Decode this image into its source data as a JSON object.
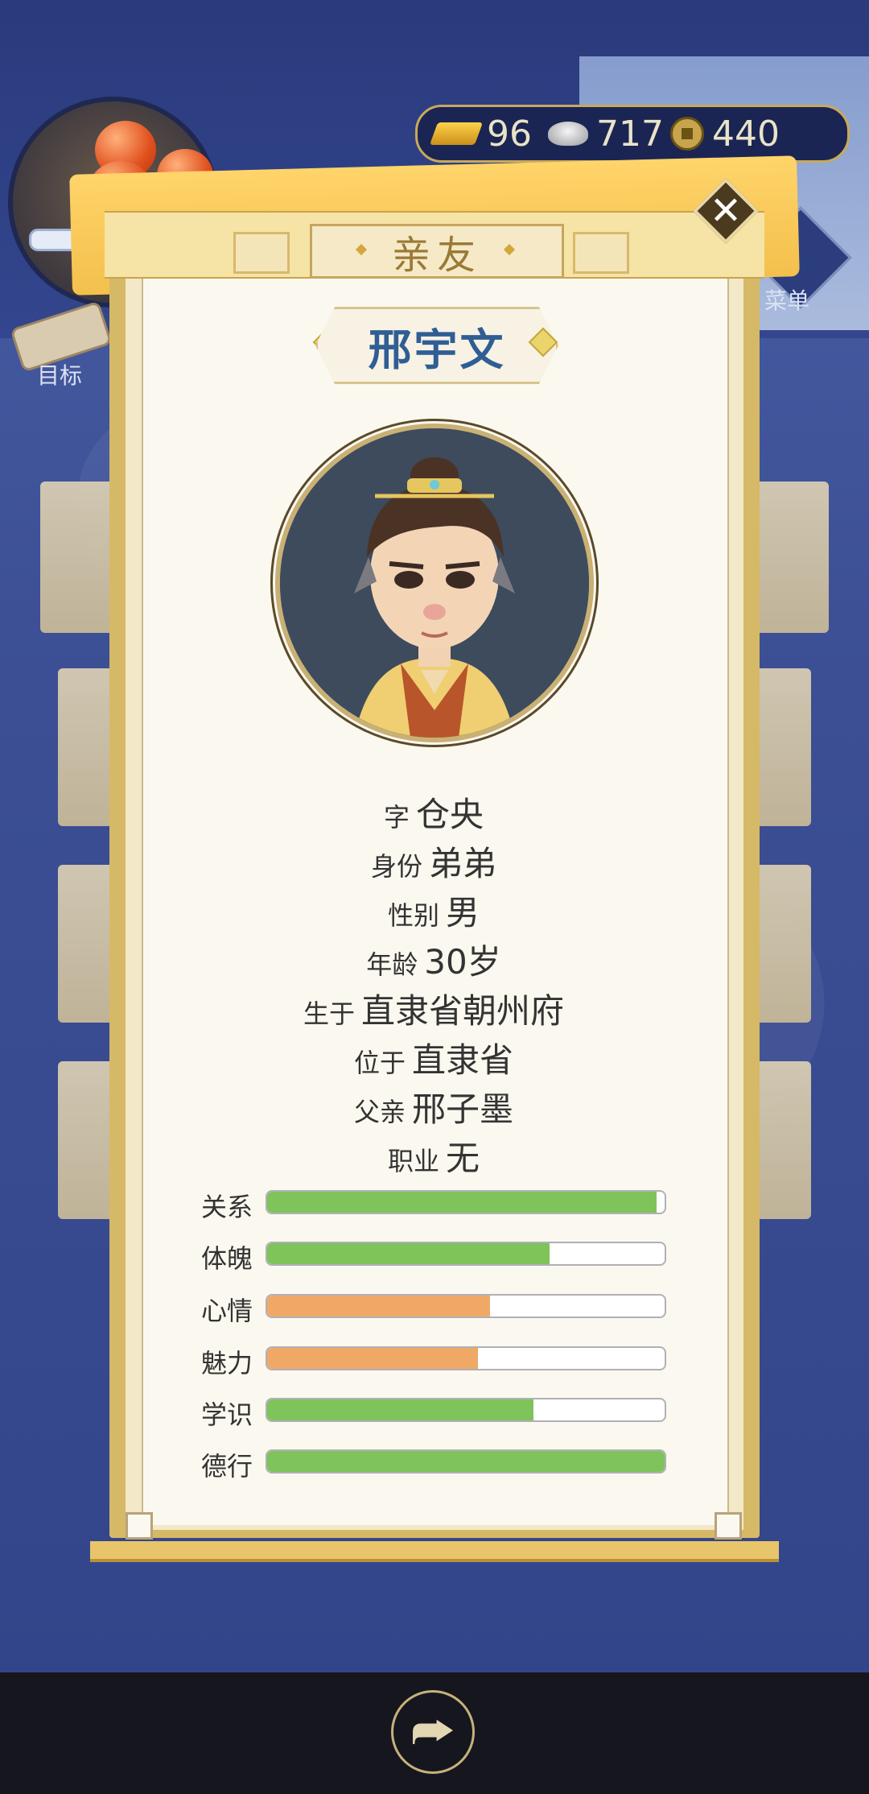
{
  "currency": {
    "gold": "96",
    "silver": "717",
    "coins": "440"
  },
  "side": {
    "goal_label": "目标",
    "menu_label": "菜单"
  },
  "dialog": {
    "title": "亲友",
    "name": "邢宇文"
  },
  "info": [
    {
      "key": "字",
      "value": "仓央"
    },
    {
      "key": "身份",
      "value": "弟弟"
    },
    {
      "key": "性别",
      "value": "男"
    },
    {
      "key": "年龄",
      "value": "30岁"
    },
    {
      "key": "生于",
      "value": "直隶省朝州府"
    },
    {
      "key": "位于",
      "value": "直隶省"
    },
    {
      "key": "父亲",
      "value": "邢子墨"
    },
    {
      "key": "职业",
      "value": "无"
    }
  ],
  "stats": [
    {
      "label": "关系",
      "fraction": 0.98,
      "color": "#7ec45a"
    },
    {
      "label": "体魄",
      "fraction": 0.71,
      "color": "#7ec45a"
    },
    {
      "label": "心情",
      "fraction": 0.56,
      "color": "#f0a866"
    },
    {
      "label": "魅力",
      "fraction": 0.53,
      "color": "#f0a866"
    },
    {
      "label": "学识",
      "fraction": 0.67,
      "color": "#7ec45a"
    },
    {
      "label": "德行",
      "fraction": 1.0,
      "color": "#7ec45a"
    }
  ]
}
